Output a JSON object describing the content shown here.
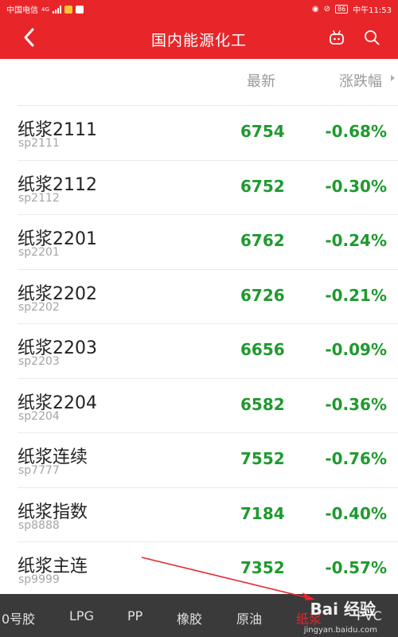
{
  "status_bar": {
    "carrier": "中国电信",
    "network": "4G",
    "battery": "86",
    "time": "中午11:53"
  },
  "nav": {
    "title": "国内能源化工",
    "back_icon": "chevron-left-icon",
    "robot_icon": "robot-icon",
    "search_icon": "search-icon"
  },
  "columns": {
    "latest": "最新",
    "change": "涨跌幅"
  },
  "rows": [
    {
      "name": "纸浆2111",
      "code": "sp2111",
      "price": "6754",
      "change": "-0.68%"
    },
    {
      "name": "纸浆2112",
      "code": "sp2112",
      "price": "6752",
      "change": "-0.30%"
    },
    {
      "name": "纸浆2201",
      "code": "sp2201",
      "price": "6762",
      "change": "-0.24%"
    },
    {
      "name": "纸浆2202",
      "code": "sp2202",
      "price": "6726",
      "change": "-0.21%"
    },
    {
      "name": "纸浆2203",
      "code": "sp2203",
      "price": "6656",
      "change": "-0.09%"
    },
    {
      "name": "纸浆2204",
      "code": "sp2204",
      "price": "6582",
      "change": "-0.36%"
    },
    {
      "name": "纸浆连续",
      "code": "sp7777",
      "price": "7552",
      "change": "-0.76%"
    },
    {
      "name": "纸浆指数",
      "code": "sp8888",
      "price": "7184",
      "change": "-0.40%"
    },
    {
      "name": "纸浆主连",
      "code": "sp9999",
      "price": "7352",
      "change": "-0.57%"
    }
  ],
  "tabs": [
    "0号胶",
    "LPG",
    "PP",
    "橡胶",
    "原油",
    "纸浆",
    "PVC"
  ],
  "active_tab": "纸浆",
  "watermark": {
    "text": "Bai 经验",
    "url": "jingyan.baidu.com"
  },
  "colors": {
    "brand_red": "#e8262a",
    "down_green": "#1f9a2f",
    "tabbar_bg": "#3a3a3a"
  }
}
